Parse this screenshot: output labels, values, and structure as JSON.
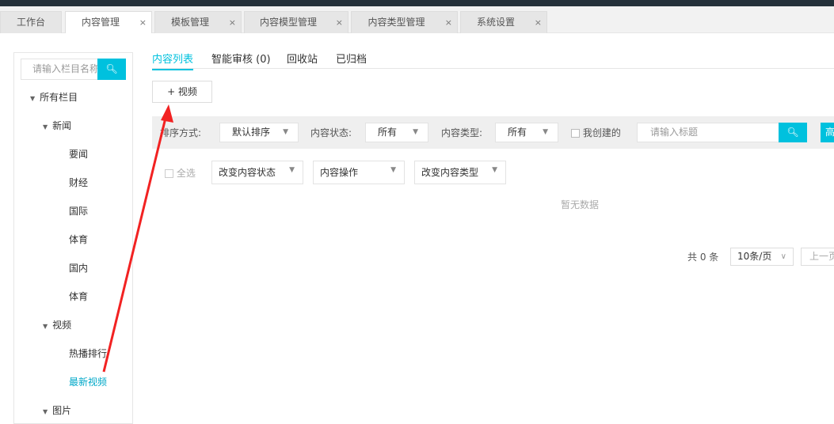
{
  "tabs": [
    {
      "label": "工作台",
      "closable": false
    },
    {
      "label": "内容管理",
      "closable": true,
      "active": true
    },
    {
      "label": "模板管理",
      "closable": true
    },
    {
      "label": "内容模型管理",
      "closable": true
    },
    {
      "label": "内容类型管理",
      "closable": true
    },
    {
      "label": "系统设置",
      "closable": true
    }
  ],
  "close_glyph": "×",
  "sidebar": {
    "search_placeholder": "请输入栏目名称",
    "tree": [
      {
        "label": "所有栏目",
        "level": 0,
        "expanded": true
      },
      {
        "label": "新闻",
        "level": 1,
        "expanded": true
      },
      {
        "label": "要闻",
        "level": 2
      },
      {
        "label": "财经",
        "level": 2
      },
      {
        "label": "国际",
        "level": 2
      },
      {
        "label": "体育",
        "level": 2
      },
      {
        "label": "国内",
        "level": 2
      },
      {
        "label": "体育",
        "level": 2
      },
      {
        "label": "视频",
        "level": 1,
        "expanded": true
      },
      {
        "label": "热播排行",
        "level": 2
      },
      {
        "label": "最新视频",
        "level": 2,
        "selected": true
      },
      {
        "label": "图片",
        "level": 1,
        "expanded": true
      }
    ]
  },
  "subtabs": [
    "内容列表",
    "智能审核 (0)",
    "回收站",
    "已归档"
  ],
  "add_button": "+ 视频",
  "filter": {
    "sort_label": "排序方式:",
    "sort_value": "默认排序",
    "status_label": "内容状态:",
    "status_value": "所有",
    "type_label": "内容类型:",
    "type_value": "所有",
    "mine_label": "我创建的",
    "title_placeholder": "请输入标题",
    "advanced": "高"
  },
  "ops": {
    "select_all": "全选",
    "change_status": "改变内容状态",
    "content_op": "内容操作",
    "change_type": "改变内容类型"
  },
  "empty": "暂无数据",
  "pager": {
    "total": "共 0 条",
    "page_size": "10条/页",
    "prev": "上一页"
  },
  "colors": {
    "accent": "#00c1de",
    "annotation": "#f22222"
  }
}
